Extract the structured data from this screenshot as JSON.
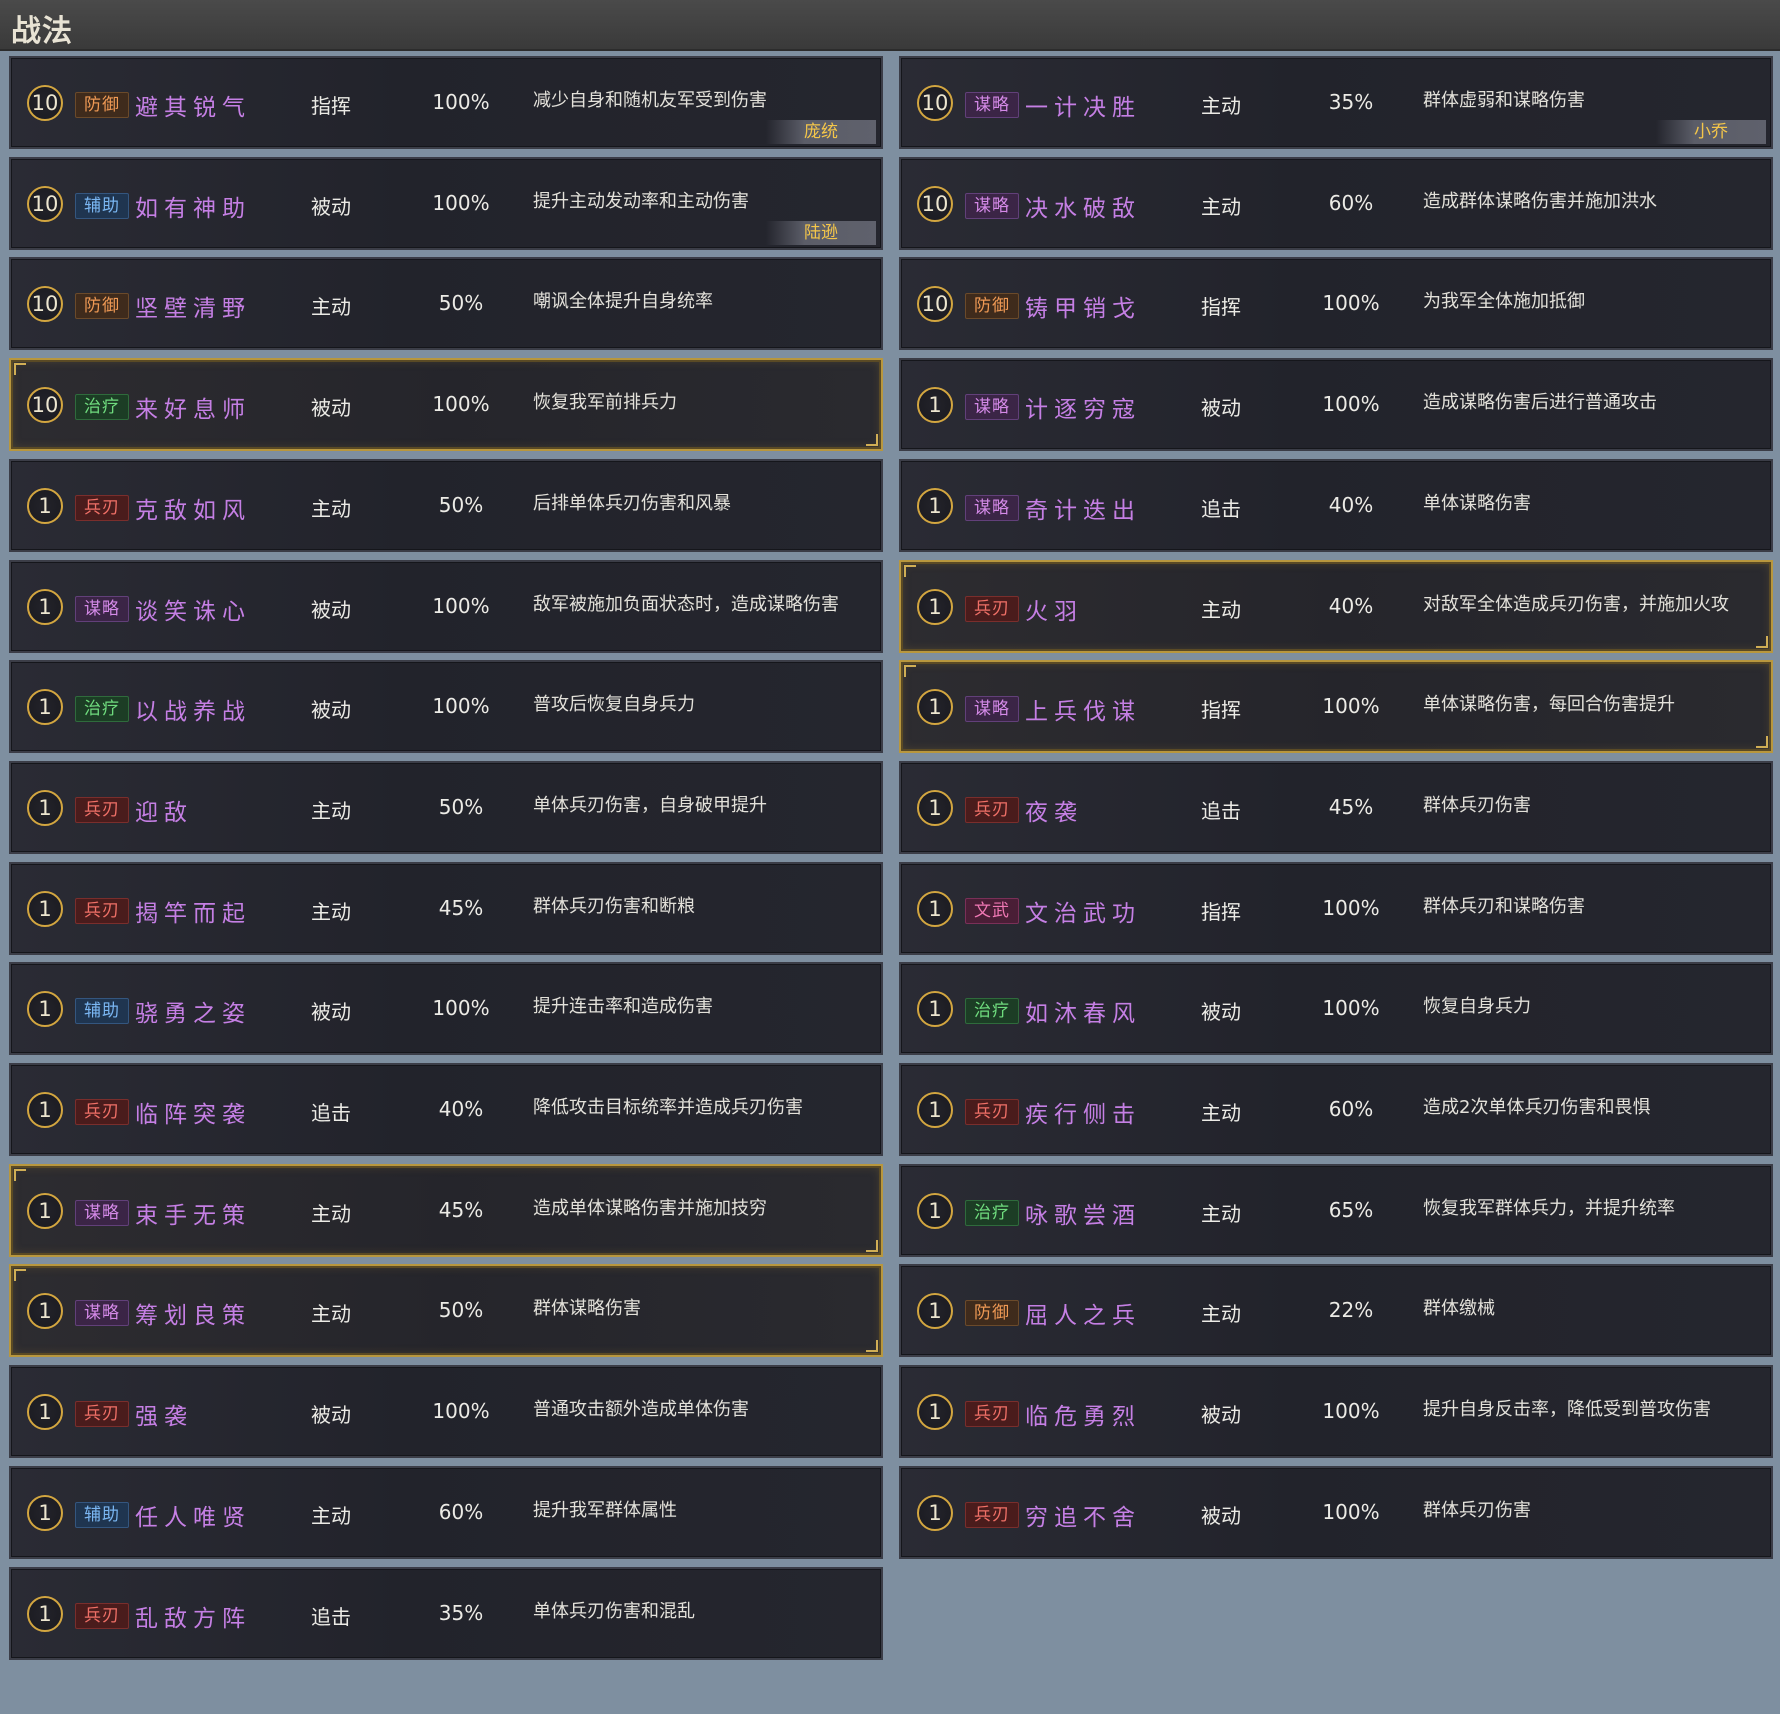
{
  "page_title": "战法",
  "colors": {
    "level_ring": "#d3a640",
    "name": "#c57fe4",
    "hero": "#f4c64a"
  },
  "left": [
    {
      "level": "10",
      "category": "防御",
      "cat_class": "def",
      "name": "避其锐气",
      "type": "指挥",
      "rate": "100%",
      "desc": "减少自身和随机友军受到伤害",
      "hero": "庞统",
      "gold": false
    },
    {
      "level": "10",
      "category": "辅助",
      "cat_class": "aux",
      "name": "如有神助",
      "type": "被动",
      "rate": "100%",
      "desc": "提升主动发动率和主动伤害",
      "hero": "陆逊",
      "gold": false
    },
    {
      "level": "10",
      "category": "防御",
      "cat_class": "def",
      "name": "坚壁清野",
      "type": "主动",
      "rate": "50%",
      "desc": "嘲讽全体提升自身统率",
      "gold": false
    },
    {
      "level": "10",
      "category": "治疗",
      "cat_class": "heal",
      "name": "来好息师",
      "type": "被动",
      "rate": "100%",
      "desc": "恢复我军前排兵力",
      "gold": true
    },
    {
      "level": "1",
      "category": "兵刃",
      "cat_class": "wpn",
      "name": "克敌如风",
      "type": "主动",
      "rate": "50%",
      "desc": "后排单体兵刃伤害和风暴",
      "gold": false
    },
    {
      "level": "1",
      "category": "谋略",
      "cat_class": "str",
      "name": "谈笑诛心",
      "type": "被动",
      "rate": "100%",
      "desc": "敌军被施加负面状态时，造成谋略伤害",
      "gold": false
    },
    {
      "level": "1",
      "category": "治疗",
      "cat_class": "heal",
      "name": "以战养战",
      "type": "被动",
      "rate": "100%",
      "desc": "普攻后恢复自身兵力",
      "gold": false
    },
    {
      "level": "1",
      "category": "兵刃",
      "cat_class": "wpn",
      "name": "迎敌",
      "type": "主动",
      "rate": "50%",
      "desc": "单体兵刃伤害，自身破甲提升",
      "gold": false
    },
    {
      "level": "1",
      "category": "兵刃",
      "cat_class": "wpn",
      "name": "揭竿而起",
      "type": "主动",
      "rate": "45%",
      "desc": "群体兵刃伤害和断粮",
      "gold": false
    },
    {
      "level": "1",
      "category": "辅助",
      "cat_class": "aux",
      "name": "骁勇之姿",
      "type": "被动",
      "rate": "100%",
      "desc": "提升连击率和造成伤害",
      "gold": false
    },
    {
      "level": "1",
      "category": "兵刃",
      "cat_class": "wpn",
      "name": "临阵突袭",
      "type": "追击",
      "rate": "40%",
      "desc": "降低攻击目标统率并造成兵刃伤害",
      "gold": false
    },
    {
      "level": "1",
      "category": "谋略",
      "cat_class": "str",
      "name": "束手无策",
      "type": "主动",
      "rate": "45%",
      "desc": "造成单体谋略伤害并施加技穷",
      "gold": true
    },
    {
      "level": "1",
      "category": "谋略",
      "cat_class": "str",
      "name": "筹划良策",
      "type": "主动",
      "rate": "50%",
      "desc": "群体谋略伤害",
      "gold": true
    },
    {
      "level": "1",
      "category": "兵刃",
      "cat_class": "wpn",
      "name": "强袭",
      "type": "被动",
      "rate": "100%",
      "desc": "普通攻击额外造成单体伤害",
      "gold": false
    },
    {
      "level": "1",
      "category": "辅助",
      "cat_class": "aux",
      "name": "任人唯贤",
      "type": "主动",
      "rate": "60%",
      "desc": "提升我军群体属性",
      "gold": false
    },
    {
      "level": "1",
      "category": "兵刃",
      "cat_class": "wpn",
      "name": "乱敌方阵",
      "type": "追击",
      "rate": "35%",
      "desc": "单体兵刃伤害和混乱",
      "gold": false
    }
  ],
  "right": [
    {
      "level": "10",
      "category": "谋略",
      "cat_class": "str",
      "name": "一计决胜",
      "type": "主动",
      "rate": "35%",
      "desc": "群体虚弱和谋略伤害",
      "hero": "小乔",
      "gold": false
    },
    {
      "level": "10",
      "category": "谋略",
      "cat_class": "str",
      "name": "决水破敌",
      "type": "主动",
      "rate": "60%",
      "desc": "造成群体谋略伤害并施加洪水",
      "gold": false
    },
    {
      "level": "10",
      "category": "防御",
      "cat_class": "def",
      "name": "铸甲销戈",
      "type": "指挥",
      "rate": "100%",
      "desc": "为我军全体施加抵御",
      "gold": false
    },
    {
      "level": "1",
      "category": "谋略",
      "cat_class": "str",
      "name": "计逐穷寇",
      "type": "被动",
      "rate": "100%",
      "desc": "造成谋略伤害后进行普通攻击",
      "gold": false
    },
    {
      "level": "1",
      "category": "谋略",
      "cat_class": "str",
      "name": "奇计迭出",
      "type": "追击",
      "rate": "40%",
      "desc": "单体谋略伤害",
      "gold": false
    },
    {
      "level": "1",
      "category": "兵刃",
      "cat_class": "wpn",
      "name": "火羽",
      "type": "主动",
      "rate": "40%",
      "desc": "对敌军全体造成兵刃伤害，并施加火攻",
      "gold": true
    },
    {
      "level": "1",
      "category": "谋略",
      "cat_class": "str",
      "name": "上兵伐谋",
      "type": "指挥",
      "rate": "100%",
      "desc": "单体谋略伤害，每回合伤害提升",
      "gold": true
    },
    {
      "level": "1",
      "category": "兵刃",
      "cat_class": "wpn",
      "name": "夜袭",
      "type": "追击",
      "rate": "45%",
      "desc": "群体兵刃伤害",
      "gold": false
    },
    {
      "level": "1",
      "category": "文武",
      "cat_class": "civ",
      "name": "文治武功",
      "type": "指挥",
      "rate": "100%",
      "desc": "群体兵刃和谋略伤害",
      "gold": false
    },
    {
      "level": "1",
      "category": "治疗",
      "cat_class": "heal",
      "name": "如沐春风",
      "type": "被动",
      "rate": "100%",
      "desc": "恢复自身兵力",
      "gold": false
    },
    {
      "level": "1",
      "category": "兵刃",
      "cat_class": "wpn",
      "name": "疾行侧击",
      "type": "主动",
      "rate": "60%",
      "desc": "造成2次单体兵刃伤害和畏惧",
      "gold": false
    },
    {
      "level": "1",
      "category": "治疗",
      "cat_class": "heal",
      "name": "咏歌尝酒",
      "type": "主动",
      "rate": "65%",
      "desc": "恢复我军群体兵力，并提升统率",
      "gold": false
    },
    {
      "level": "1",
      "category": "防御",
      "cat_class": "def",
      "name": "屈人之兵",
      "type": "主动",
      "rate": "22%",
      "desc": "群体缴械",
      "gold": false
    },
    {
      "level": "1",
      "category": "兵刃",
      "cat_class": "wpn",
      "name": "临危勇烈",
      "type": "被动",
      "rate": "100%",
      "desc": "提升自身反击率，降低受到普攻伤害",
      "gold": false
    },
    {
      "level": "1",
      "category": "兵刃",
      "cat_class": "wpn",
      "name": "穷追不舍",
      "type": "被动",
      "rate": "100%",
      "desc": "群体兵刃伤害",
      "gold": false
    }
  ]
}
